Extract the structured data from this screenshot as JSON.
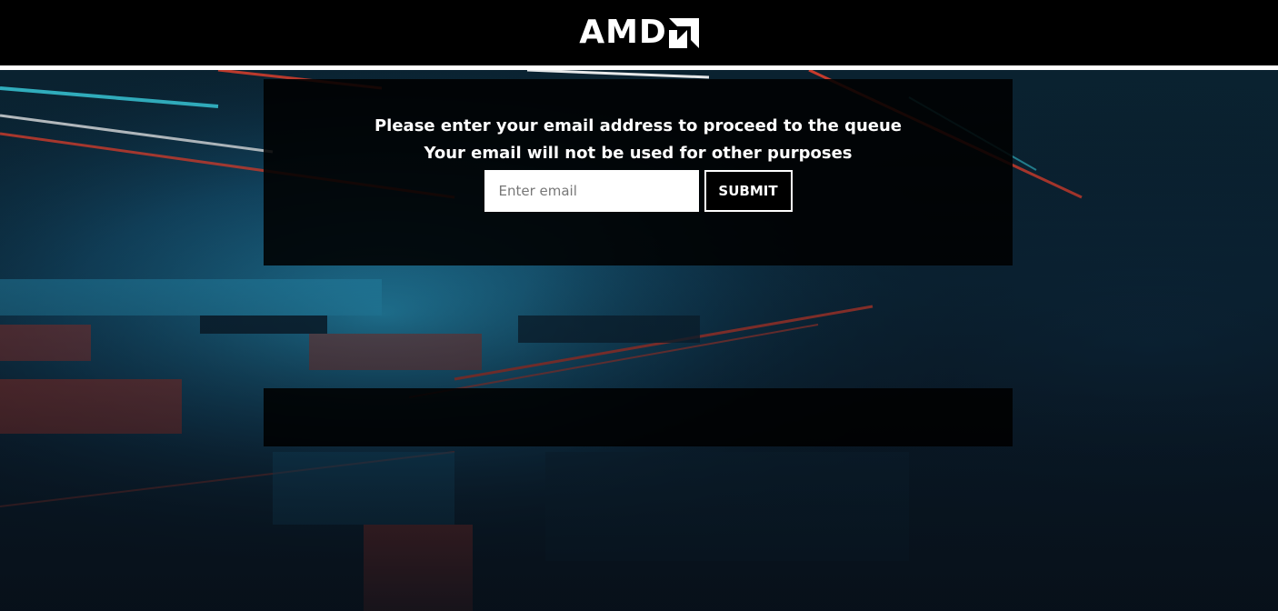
{
  "header": {
    "logo_text": "AMD",
    "logo_icon": "amd-arrow-icon"
  },
  "queue_form": {
    "message_line1": "Please enter your email address to proceed to the queue",
    "message_line2": "Your email will not be used for other purposes",
    "email_input": {
      "value": "",
      "placeholder": "Enter email"
    },
    "submit_label": "SUBMIT"
  },
  "colors": {
    "header_bg": "#000000",
    "accent_cyan": "#3cd6e6",
    "accent_red": "#e8402c",
    "panel_bg": "rgba(0,0,0,0.88)"
  }
}
